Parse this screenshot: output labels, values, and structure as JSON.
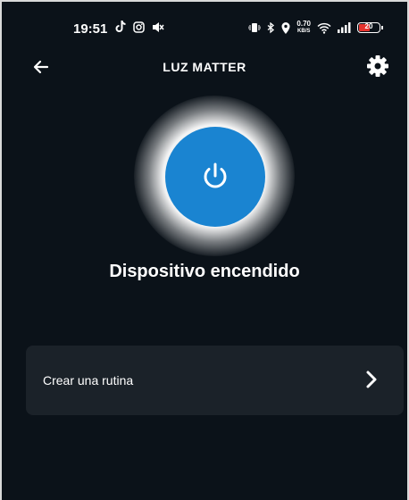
{
  "status_bar": {
    "time": "19:51",
    "left_icons": [
      "tiktok-icon",
      "instagram-icon",
      "muted-icon"
    ],
    "right_icons": [
      "vibrate-icon",
      "bluetooth-icon",
      "location-icon",
      "wifi-icon",
      "signal-icon"
    ],
    "speed_value": "0.70",
    "speed_unit": "KB/S",
    "battery": "20"
  },
  "header": {
    "title": "LUZ MATTER",
    "back_icon": "back-arrow-icon",
    "settings_icon": "gear-icon"
  },
  "device": {
    "status_text": "Dispositivo encendido",
    "power_icon": "power-icon",
    "accent_color": "#1a84d1"
  },
  "routine": {
    "label": "Crear una rutina",
    "chevron_icon": "chevron-right-icon"
  }
}
